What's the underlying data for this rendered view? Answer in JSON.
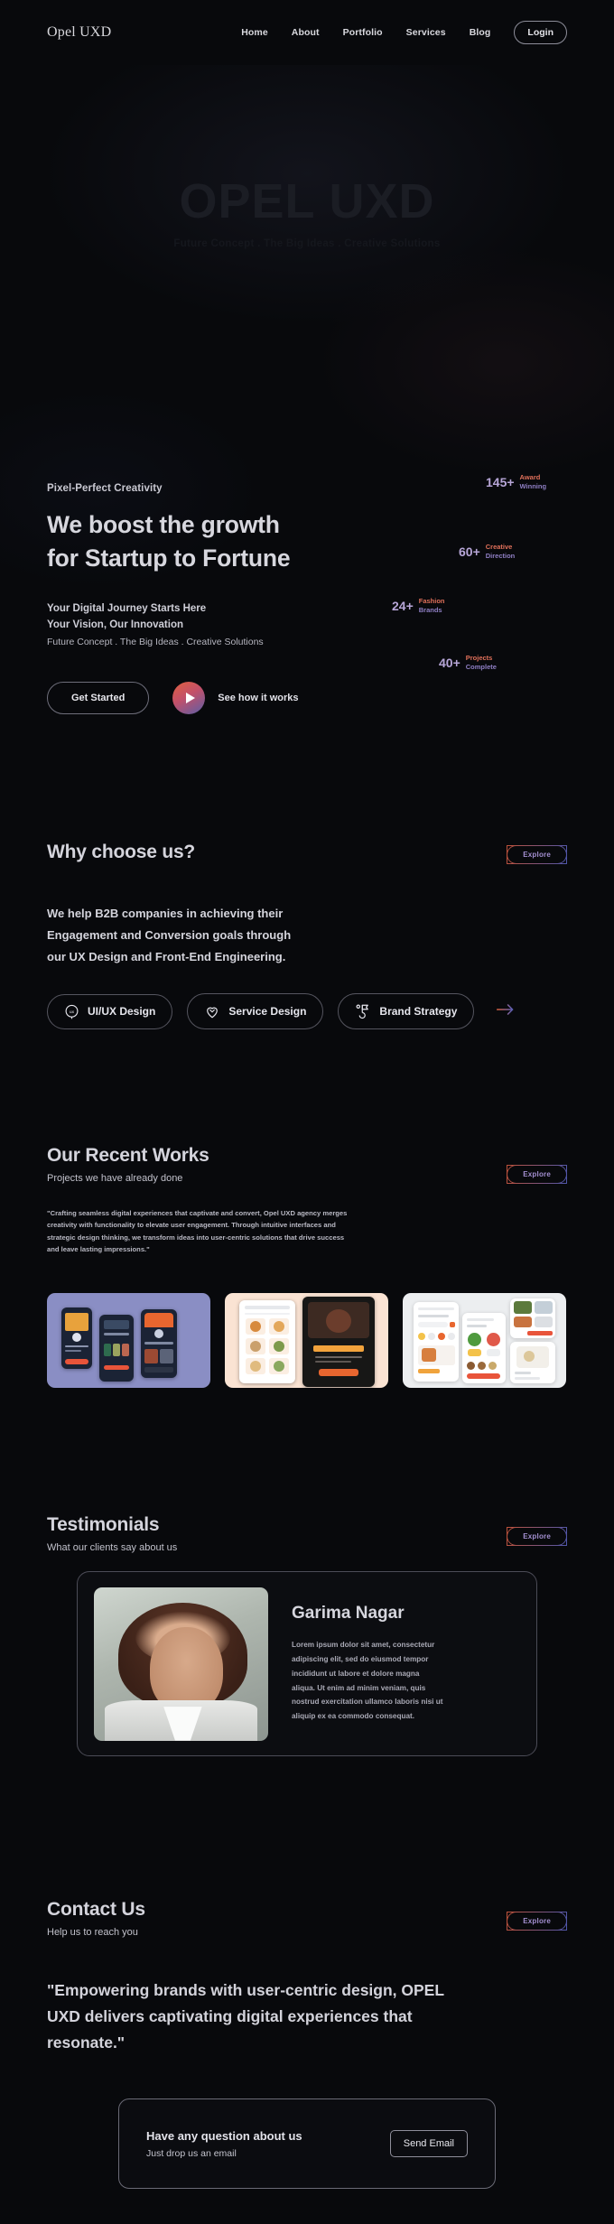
{
  "brand": {
    "logo": "Opel UXD"
  },
  "nav": {
    "links": [
      "Home",
      "About",
      "Portfolio",
      "Services",
      "Blog"
    ],
    "login_label": "Login"
  },
  "hero": {
    "watermark_title": "OPEL UXD",
    "watermark_sub": "Future Concept . The Big Ideas . Creative Solutions",
    "eyebrow": "Pixel-Perfect Creativity",
    "heading_line1": "We boost the growth",
    "heading_line2": "for Startup to Fortune",
    "sub_line1": "Your Digital Journey Starts Here",
    "sub_line2": "Your Vision, Our Innovation",
    "sub_line3": "Future Concept . The Big Ideas . Creative Solutions",
    "primary_cta": "Get Started",
    "video_cta": "See how it works",
    "stats": [
      {
        "value": "145+",
        "label_line1": "Award",
        "label_line2": "Winning"
      },
      {
        "value": "60+",
        "label_line1": "Creative",
        "label_line2": "Direction"
      },
      {
        "value": "24+",
        "label_line1": "Fashion",
        "label_line2": "Brands"
      },
      {
        "value": "40+",
        "label_line1": "Projects",
        "label_line2": "Complete"
      }
    ]
  },
  "why": {
    "title": "Why choose us?",
    "explore_label": "Explore",
    "body_line1": "We help B2B companies in achieving their",
    "body_line2": "Engagement and Conversion goals through",
    "body_line3": "our UX Design and Front-End Engineering.",
    "pills": [
      {
        "label": "UI/UX Design",
        "icon": "ux-badge-icon"
      },
      {
        "label": "Service Design",
        "icon": "heart-pin-icon"
      },
      {
        "label": "Brand Strategy",
        "icon": "flag-key-icon"
      }
    ],
    "next_icon": "arrow-right-icon"
  },
  "works": {
    "title": "Our Recent Works",
    "subtitle": "Projects we have already done",
    "explore_label": "Explore",
    "quote_line1": "\"Crafting seamless digital experiences that captivate and convert, Opel UXD agency merges",
    "quote_line2": "creativity with functionality to elevate user engagement. Through intuitive interfaces and",
    "quote_line3": "strategic design thinking, we transform ideas into user-centric solutions that drive success",
    "quote_line4": "and leave lasting impressions.\"",
    "cards": [
      {
        "name": "movie-booking-app-mockups",
        "accent": "#8a8ec4"
      },
      {
        "name": "yummies-food-app-mockups",
        "accent": "#fae3d3"
      },
      {
        "name": "restaurant-finder-mockups",
        "accent": "#eceef0"
      }
    ]
  },
  "testimonials": {
    "title": "Testimonials",
    "subtitle": "What our clients say about us",
    "explore_label": "Explore",
    "person_name": "Garima Nagar",
    "quote_line1": "Lorem ipsum dolor sit amet, consectetur",
    "quote_line2": "adipiscing elit, sed do eiusmod tempor",
    "quote_line3": "incididunt ut labore et dolore magna",
    "quote_line4": "aliqua. Ut enim ad minim veniam, quis",
    "quote_line5": "nostrud exercitation ullamco laboris nisi ut",
    "quote_line6": "aliquip ex ea commodo consequat."
  },
  "contact": {
    "title": "Contact Us",
    "subtitle": "Help us to reach you",
    "explore_label": "Explore",
    "quote_line1": "\"Empowering brands with user-centric design, OPEL",
    "quote_line2": "UXD delivers captivating digital experiences that",
    "quote_line3": "resonate.\"",
    "card_title": "Have any question about us",
    "card_sub": "Just drop us an email",
    "card_button": "Send Email"
  },
  "colors": {
    "background": "#08090c",
    "accent_orange": "#e0705a",
    "accent_purple": "#8f7fc4",
    "stat_number": "#b7a6d8",
    "text_primary": "#d7d7de"
  }
}
